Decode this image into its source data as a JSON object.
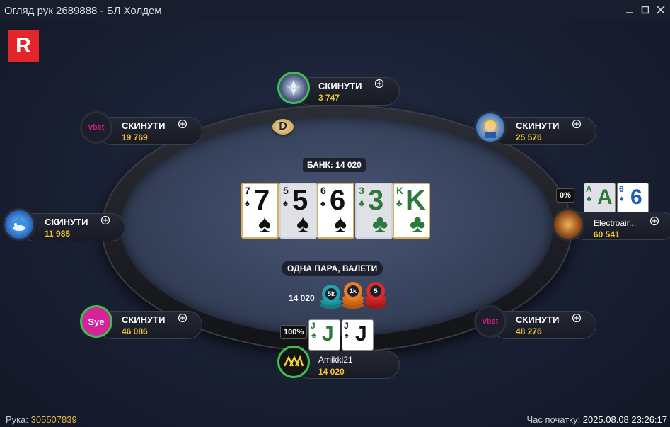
{
  "window": {
    "title": "Огляд рук 2689888 - БЛ Холдем",
    "minimize_icon": "minimize-icon",
    "maximize_icon": "maximize-icon",
    "close_icon": "close-icon"
  },
  "logo": {
    "text": "R",
    "color": "#e3262a"
  },
  "table": {
    "dealer_button": "D",
    "pot_label": "БАНК: 14 020",
    "hand_result": "ОДНА ПАРА, ВАЛЕТИ",
    "pot_amount": "14 020",
    "chips": [
      "5k",
      "1k",
      "5"
    ],
    "board": [
      {
        "rank": "7",
        "suit": "♠"
      },
      {
        "rank": "5",
        "suit": "♠"
      },
      {
        "rank": "6",
        "suit": "♠"
      },
      {
        "rank": "3",
        "suit": "♣"
      },
      {
        "rank": "K",
        "suit": "♣"
      }
    ]
  },
  "seats": {
    "top": {
      "action": "СКИНУТИ",
      "stack": "3 747"
    },
    "top_left": {
      "action": "СКИНУТИ",
      "stack": "19 769",
      "avatar": "vbet"
    },
    "top_right": {
      "action": "СКИНУТИ",
      "stack": "25 576"
    },
    "left": {
      "action": "СКИНУТИ",
      "stack": "11 985"
    },
    "right": {
      "name": "Electroair...",
      "stack": "60 541",
      "equity": "0%",
      "cards": [
        {
          "rank": "A",
          "suit": "♣"
        },
        {
          "rank": "6",
          "suit": "♦"
        }
      ]
    },
    "bottom_left": {
      "action": "СКИНУТИ",
      "stack": "46 086",
      "avatar": "Sye"
    },
    "bottom_right": {
      "action": "СКИНУТИ",
      "stack": "48 276",
      "avatar": "vbet"
    },
    "hero": {
      "name": "Amikki21",
      "stack": "14 020",
      "equity": "100%",
      "cards": [
        {
          "rank": "J",
          "suit": "♣"
        },
        {
          "rank": "J",
          "suit": "♠"
        }
      ]
    }
  },
  "footer": {
    "hand_label": "Рука:",
    "hand_id": "305507839",
    "start_label": "Час початку:",
    "start_time": "2025.08.08 23:26:17"
  },
  "colors": {
    "stack": "#f2c230",
    "active_ring": "#3fbf4f",
    "card_border": "#d8b15a"
  }
}
